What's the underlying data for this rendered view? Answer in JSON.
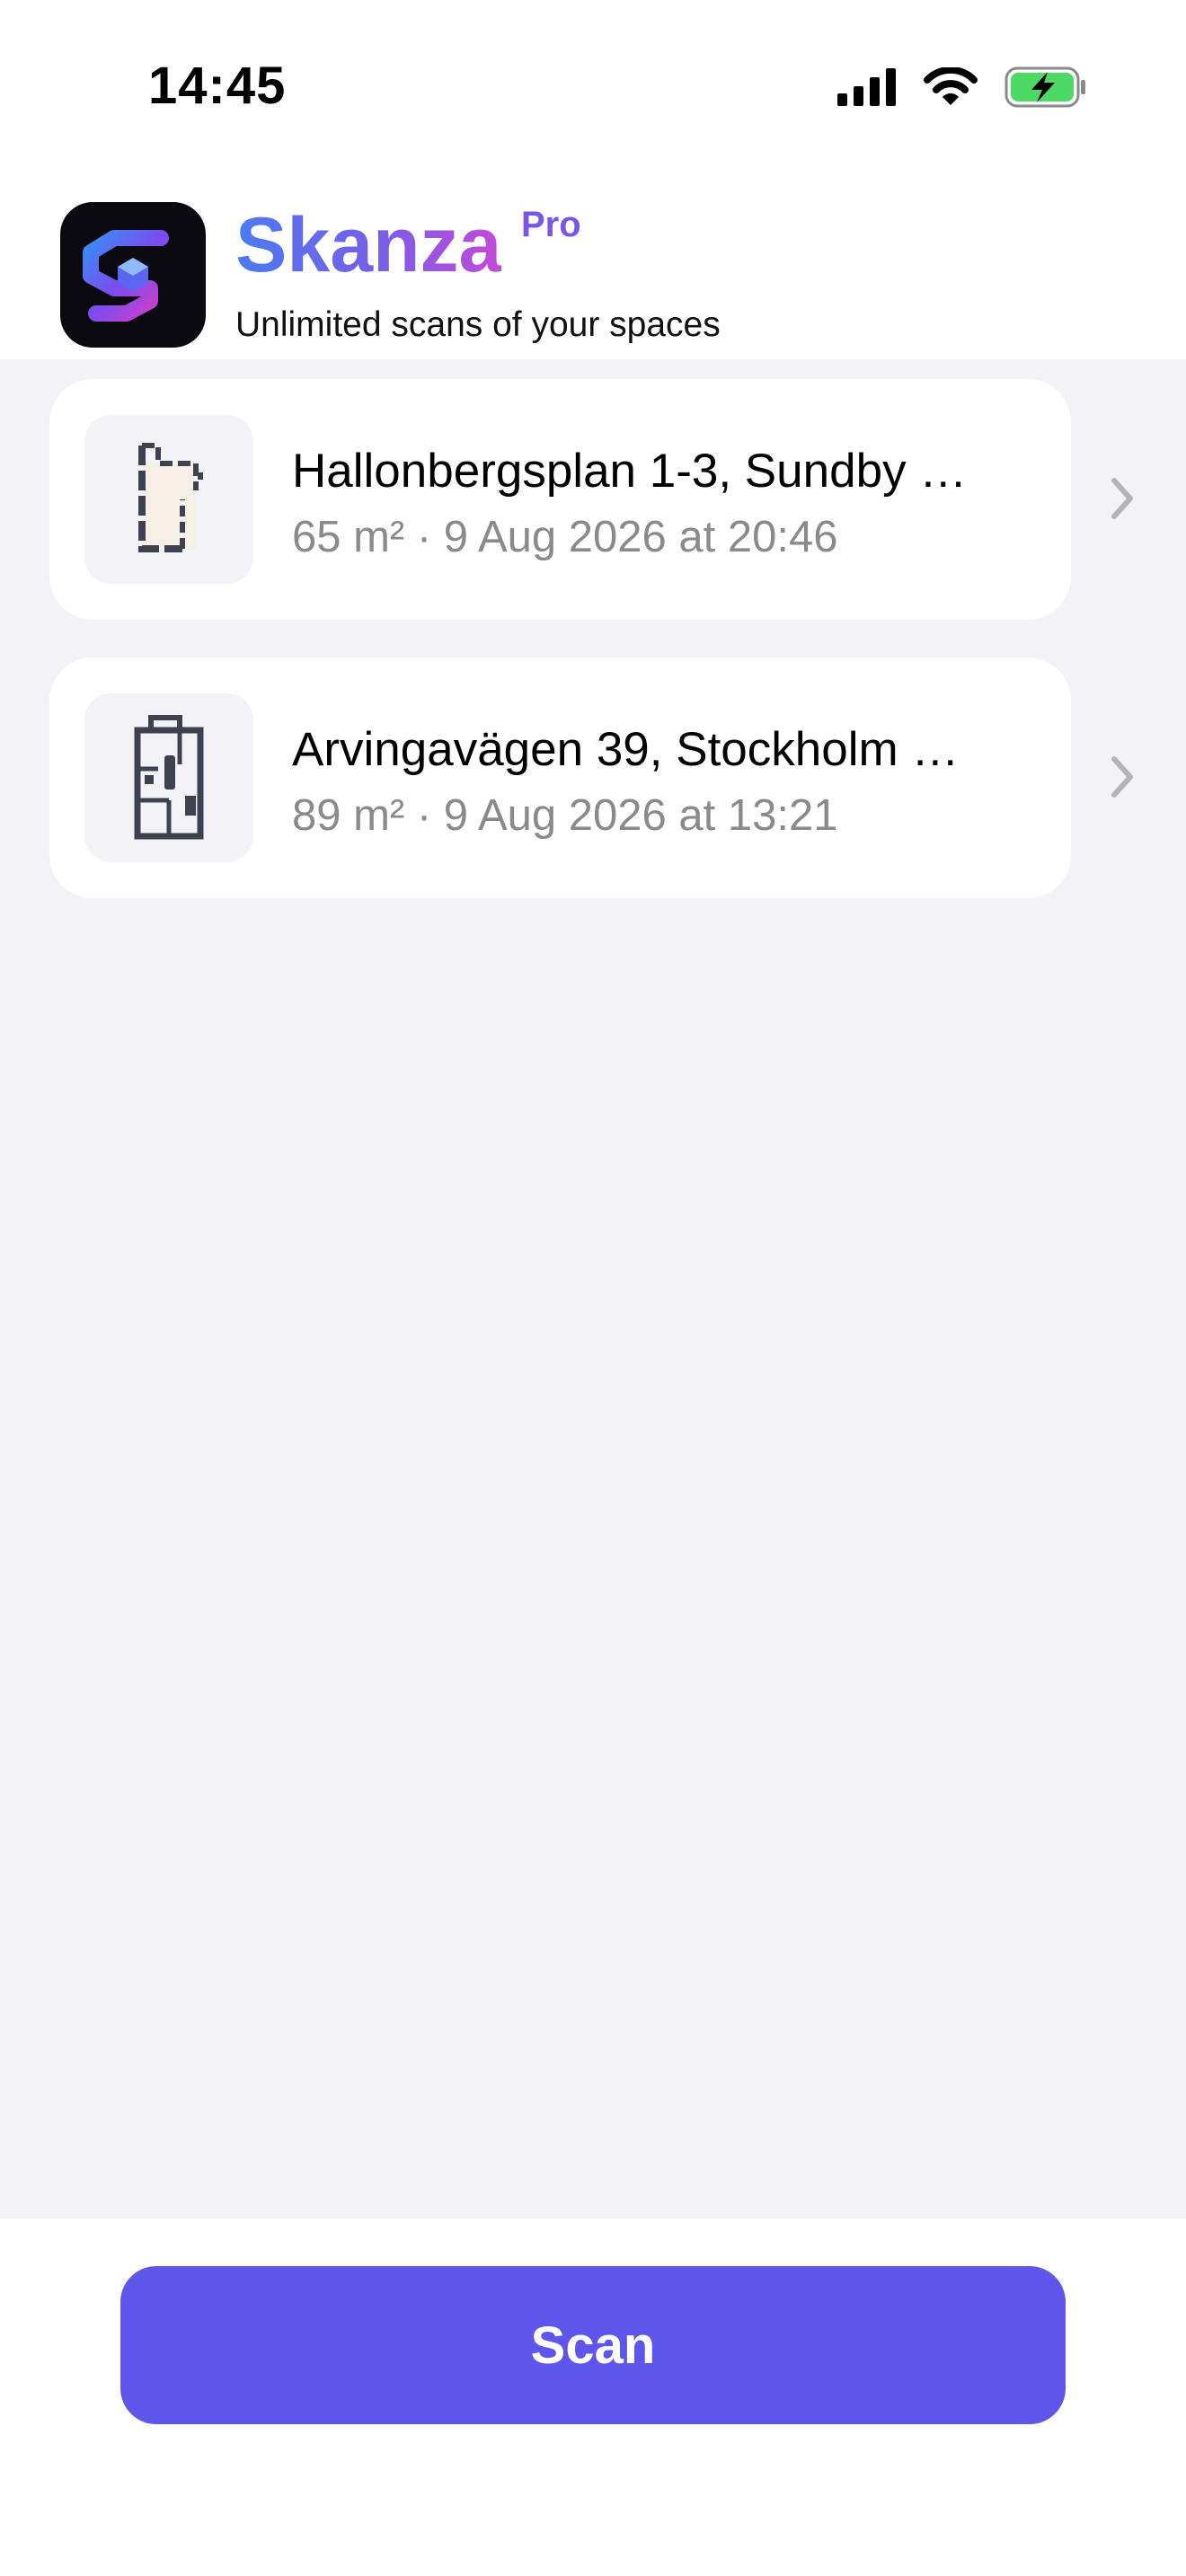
{
  "status_bar": {
    "time": "14:45",
    "icons": [
      "cellular-signal-icon",
      "wifi-icon",
      "battery-charging-icon"
    ]
  },
  "header": {
    "app_name": "Skanza",
    "badge": "Pro",
    "tagline": "Unlimited scans of your spaces",
    "logo_icon": "app-logo-icon"
  },
  "scans": [
    {
      "title": "Hallonbergsplan 1-3, Sundby …",
      "meta": "65 m² · 9 Aug 2026 at 20:46",
      "thumbnail_icon": "floorplan-thumbnail-icon"
    },
    {
      "title": "Arvingavägen 39, Stockholm …",
      "meta": "89 m² · 9 Aug 2026 at 13:21",
      "thumbnail_icon": "floorplan-thumbnail-icon"
    }
  ],
  "actions": {
    "scan_label": "Scan"
  },
  "colors": {
    "accent": "#5E55EA",
    "list_background": "#F2F2F7",
    "secondary_text": "#8A8A8E",
    "battery_fill": "#4CD964"
  }
}
